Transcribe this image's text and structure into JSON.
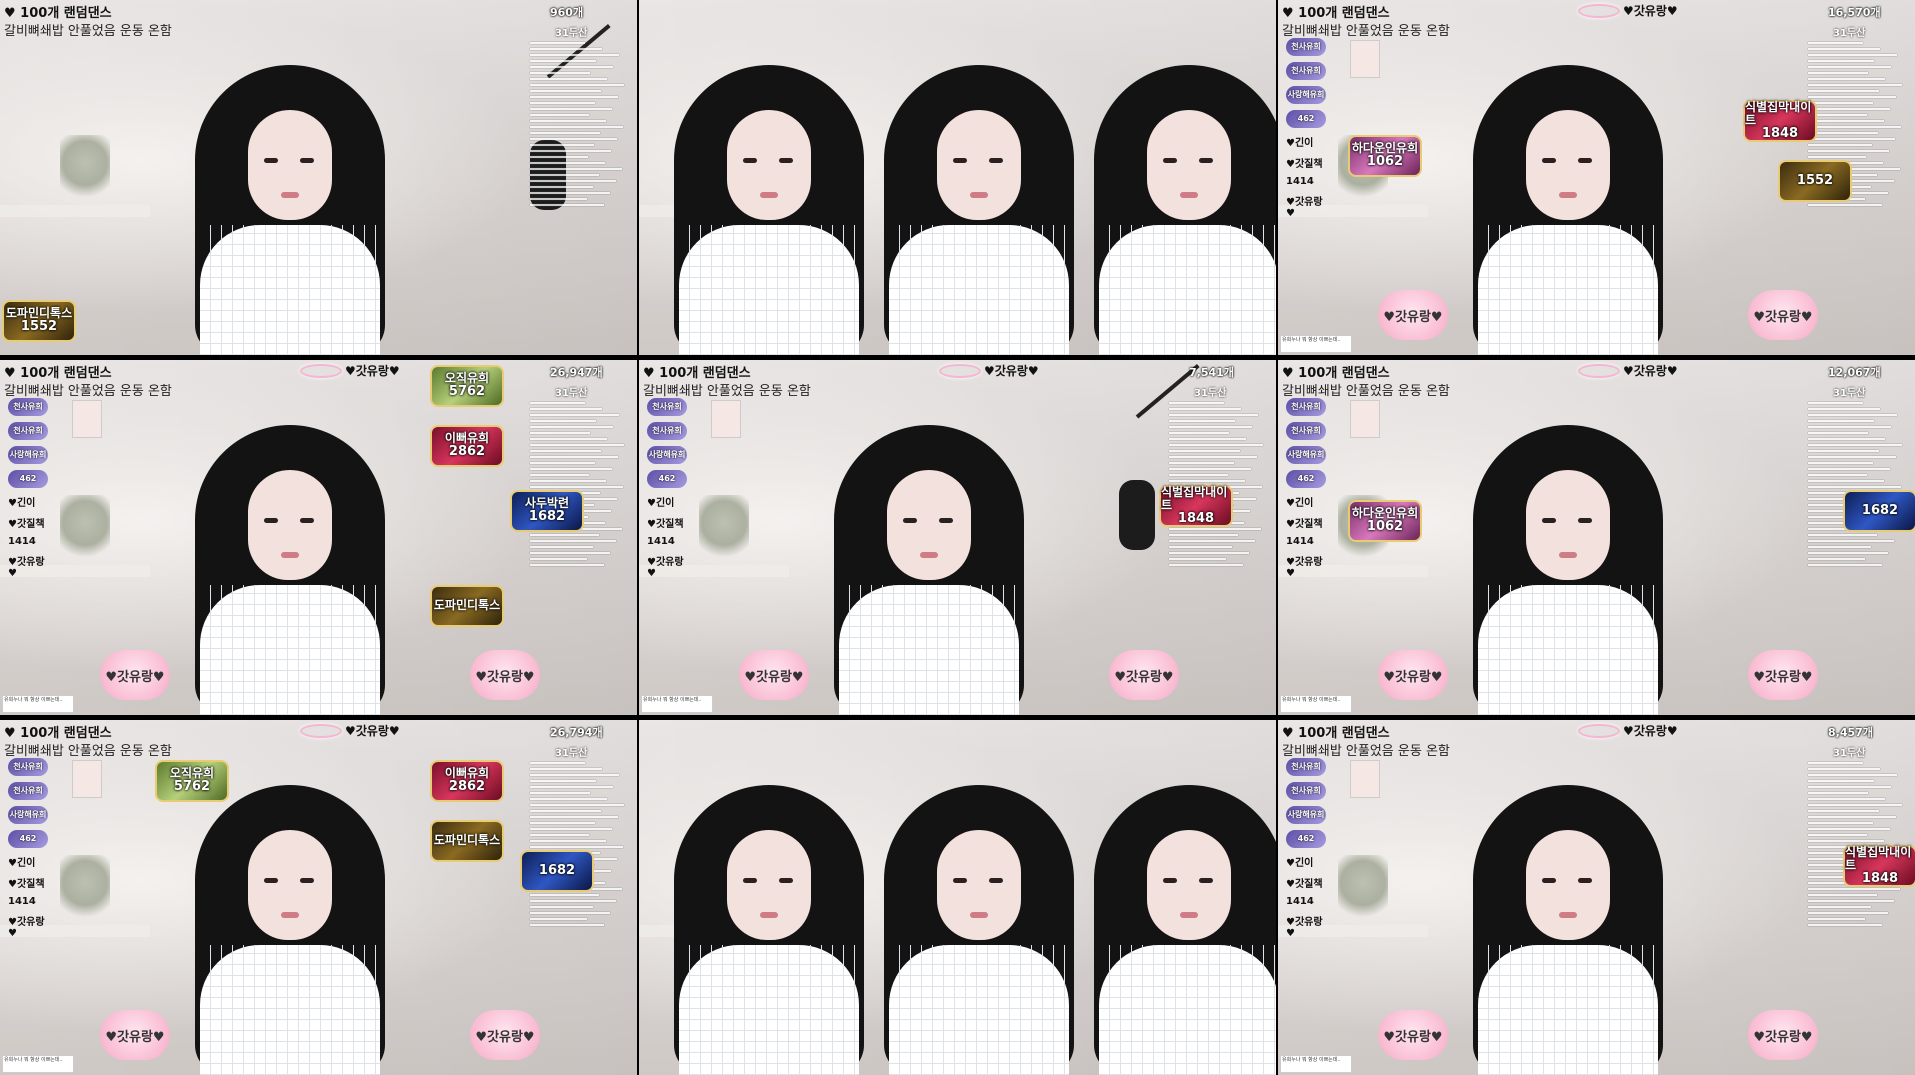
{
  "overlay": {
    "title_line1": "♥ 100개 랜덤댄스",
    "title_line2": "갈비뼈쇄밥 안풀었음 운동 온함",
    "right_sub": "31두산",
    "heart_label": "♥갓유랑♥",
    "bubble_label": "♥갓유랑♥"
  },
  "tiles": [
    {
      "count": "960개",
      "badges": [
        {
          "text": "도파민디톡스",
          "num": "1552",
          "style": "gold"
        }
      ]
    },
    {
      "count": "",
      "badges": []
    },
    {
      "count": "16,570개",
      "badges": [
        {
          "text": "하다운인유희",
          "num": "1062",
          "style": "pink"
        },
        {
          "text": "식별집막내이트",
          "num": "1848",
          "style": "red"
        },
        {
          "text": "",
          "num": "1552",
          "style": "gold"
        }
      ]
    },
    {
      "count": "26,947개",
      "badges": [
        {
          "text": "오직유희",
          "num": "5762",
          "style": "green"
        },
        {
          "text": "이뻐유희",
          "num": "2862",
          "style": "red"
        },
        {
          "text": "사두박련",
          "num": "1682",
          "style": "blue"
        },
        {
          "text": "도파민디톡스",
          "num": "",
          "style": "gold"
        }
      ]
    },
    {
      "count": "7,541개",
      "badges": [
        {
          "text": "식벌집막내이트",
          "num": "1848",
          "style": "red"
        }
      ]
    },
    {
      "count": "12,067개",
      "badges": [
        {
          "text": "하다운인유희",
          "num": "1062",
          "style": "pink"
        },
        {
          "text": "",
          "num": "1682",
          "style": "blue"
        }
      ]
    },
    {
      "count": "26,794개",
      "badges": [
        {
          "text": "오직유희",
          "num": "5762",
          "style": "green"
        },
        {
          "text": "이뻐유희",
          "num": "2862",
          "style": "red"
        },
        {
          "text": "",
          "num": "1682",
          "style": "blue"
        },
        {
          "text": "도파민디톡스",
          "num": "",
          "style": "gold"
        }
      ]
    },
    {
      "count": "",
      "badges": []
    },
    {
      "count": "8,457개",
      "badges": [
        {
          "text": "식별집막내이트",
          "num": "1848",
          "style": "red"
        }
      ]
    }
  ],
  "left_stack": {
    "pills": [
      "천사유희",
      "천사유희",
      "사랑해유희",
      "462"
    ],
    "tags": [
      "♥긴이",
      "♥갓질책",
      "1414",
      "♥갓유랑♥"
    ]
  }
}
